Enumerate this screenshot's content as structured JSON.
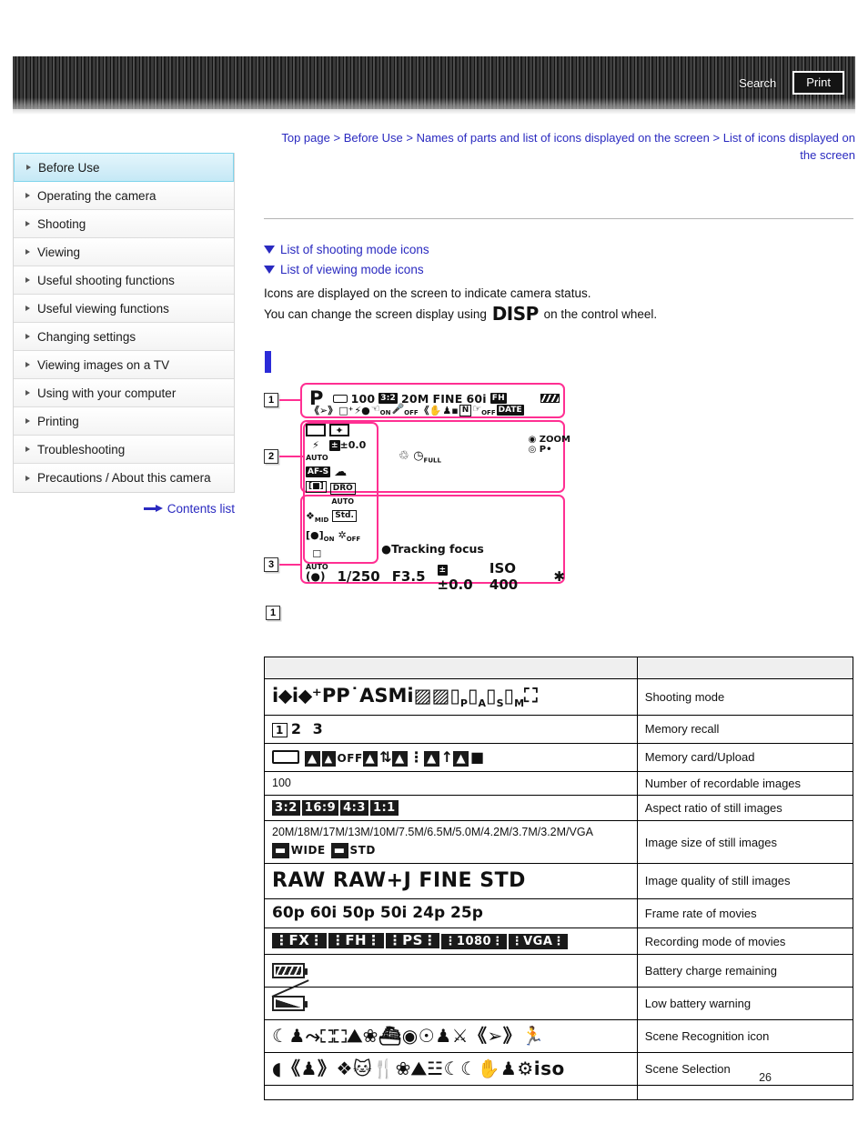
{
  "header": {
    "search_label": "Search",
    "print_label": "Print"
  },
  "breadcrumb": {
    "items": [
      "Top page",
      "Before Use",
      "Names of parts and list of icons displayed on the screen",
      "List of icons displayed on the screen"
    ],
    "separator": ">"
  },
  "sidebar": {
    "items": [
      {
        "label": "Before Use",
        "active": true
      },
      {
        "label": "Operating the camera",
        "active": false
      },
      {
        "label": "Shooting",
        "active": false
      },
      {
        "label": "Viewing",
        "active": false
      },
      {
        "label": "Useful shooting functions",
        "active": false
      },
      {
        "label": "Useful viewing functions",
        "active": false
      },
      {
        "label": "Changing settings",
        "active": false
      },
      {
        "label": "Viewing images on a TV",
        "active": false
      },
      {
        "label": "Using with your computer",
        "active": false
      },
      {
        "label": "Printing",
        "active": false
      },
      {
        "label": "Troubleshooting",
        "active": false
      },
      {
        "label": "Precautions / About this camera",
        "active": false
      }
    ],
    "contents_list_label": "Contents list"
  },
  "main": {
    "toggle_links": [
      "List of shooting mode icons",
      "List of viewing mode icons"
    ],
    "paragraph_1": "Icons are displayed on the screen to indicate camera status.",
    "paragraph_2_before": "You can change the screen display using",
    "paragraph_2_glyph": "DISP",
    "paragraph_2_after": "on the control wheel."
  },
  "diagram": {
    "markers": [
      "1",
      "2",
      "3"
    ],
    "section_marker_below": "1",
    "row1": {
      "mode": "P",
      "card_icon": "memory-card-icon",
      "recordable": "100",
      "aspect": "3:2",
      "size": "20M",
      "quality": "FINE",
      "framerate": "60i",
      "recmode": "FH",
      "battery": "battery-icon"
    },
    "row2_icons": [
      "scene-recognition",
      "continuous-shooting",
      "flash",
      "af-illuminator-on",
      "wind-noise-off",
      "steadyshot",
      "smile-shutter",
      "nfc",
      "face-registration-off",
      "date"
    ],
    "left_column": [
      {
        "left": "drive-mode",
        "right": "metering-mode"
      },
      {
        "left": "flash-auto",
        "right": "exposure-comp",
        "right_label": "±0.0"
      },
      {
        "left": "AF-S",
        "right": "white-balance-cloudy"
      },
      {
        "left": "af-area",
        "right": "DRO AUTO"
      },
      {
        "left": "soft-skin-mid",
        "right": "Std."
      },
      {
        "left": "audio-rec-on",
        "right": "picture-effect-off"
      },
      {
        "left": "auto-framing",
        "right": ""
      }
    ],
    "mid_icons": [
      "hand-shake-warning",
      "full-memory"
    ],
    "right_icons": [
      "zoom",
      "program-shift"
    ],
    "tracking_focus_label": "Tracking focus",
    "bottom": {
      "smart_zoom": "smart-zoom-icon",
      "shutter_speed": "1/250",
      "aperture": "F3.5",
      "exposure_comp": "±0.0",
      "iso": "ISO 400",
      "ae_lock": "AE-L"
    }
  },
  "table": {
    "rows": [
      {
        "icons": "i⌂ i⌂⁺ PP˙ ASM i██ ▭ₘ ▭P ▭A ▭S ▭M ▭",
        "type": "shooting-mode",
        "label": "Shooting mode"
      },
      {
        "icons": "1 2 3",
        "type": "memory-recall",
        "label": "Memory recall"
      },
      {
        "icons": "card OFF ↕ ⋮ ↑ ■",
        "type": "memory-card",
        "label": "Memory card/Upload"
      },
      {
        "icons": "100",
        "type": "plain",
        "label": "Number of recordable images"
      },
      {
        "icons": "3:2 16:9 4:3 1:1",
        "type": "aspect",
        "label": "Aspect ratio of still images"
      },
      {
        "icons": "20M/18M/17M/13M/10M/7.5M/6.5M/5.0M/4.2M/3.7M/3.2M/VGA",
        "icons2": "WIDE STD",
        "type": "image-size",
        "label": "Image size of still images"
      },
      {
        "icons": "RAW RAW+J FINE STD",
        "type": "quality",
        "label": "Image quality of still images"
      },
      {
        "icons": "60p 60i 50p 50i 24p 25p",
        "type": "framerate",
        "label": "Frame rate of movies"
      },
      {
        "icons": "FX FH PS 1080 VGA",
        "type": "recmode",
        "label": "Recording mode of movies"
      },
      {
        "icons": "battery",
        "type": "battery",
        "label": "Battery charge remaining"
      },
      {
        "icons": "battery-low",
        "type": "battery-low",
        "label": "Low battery warning"
      },
      {
        "icons": "scene-recognition-set",
        "type": "scene-rec",
        "label": "Scene Recognition icon"
      },
      {
        "icons": "scene-selection-set",
        "type": "scene-sel",
        "label": "Scene Selection"
      },
      {
        "icons": "",
        "type": "empty",
        "label": ""
      }
    ]
  },
  "footer": {
    "page_number": "26"
  },
  "colors": {
    "link": "#2a2ac0",
    "diagram_accent": "#ff2f92",
    "active_nav": "#d3eef8",
    "header_bar": "#2e2e2e"
  }
}
